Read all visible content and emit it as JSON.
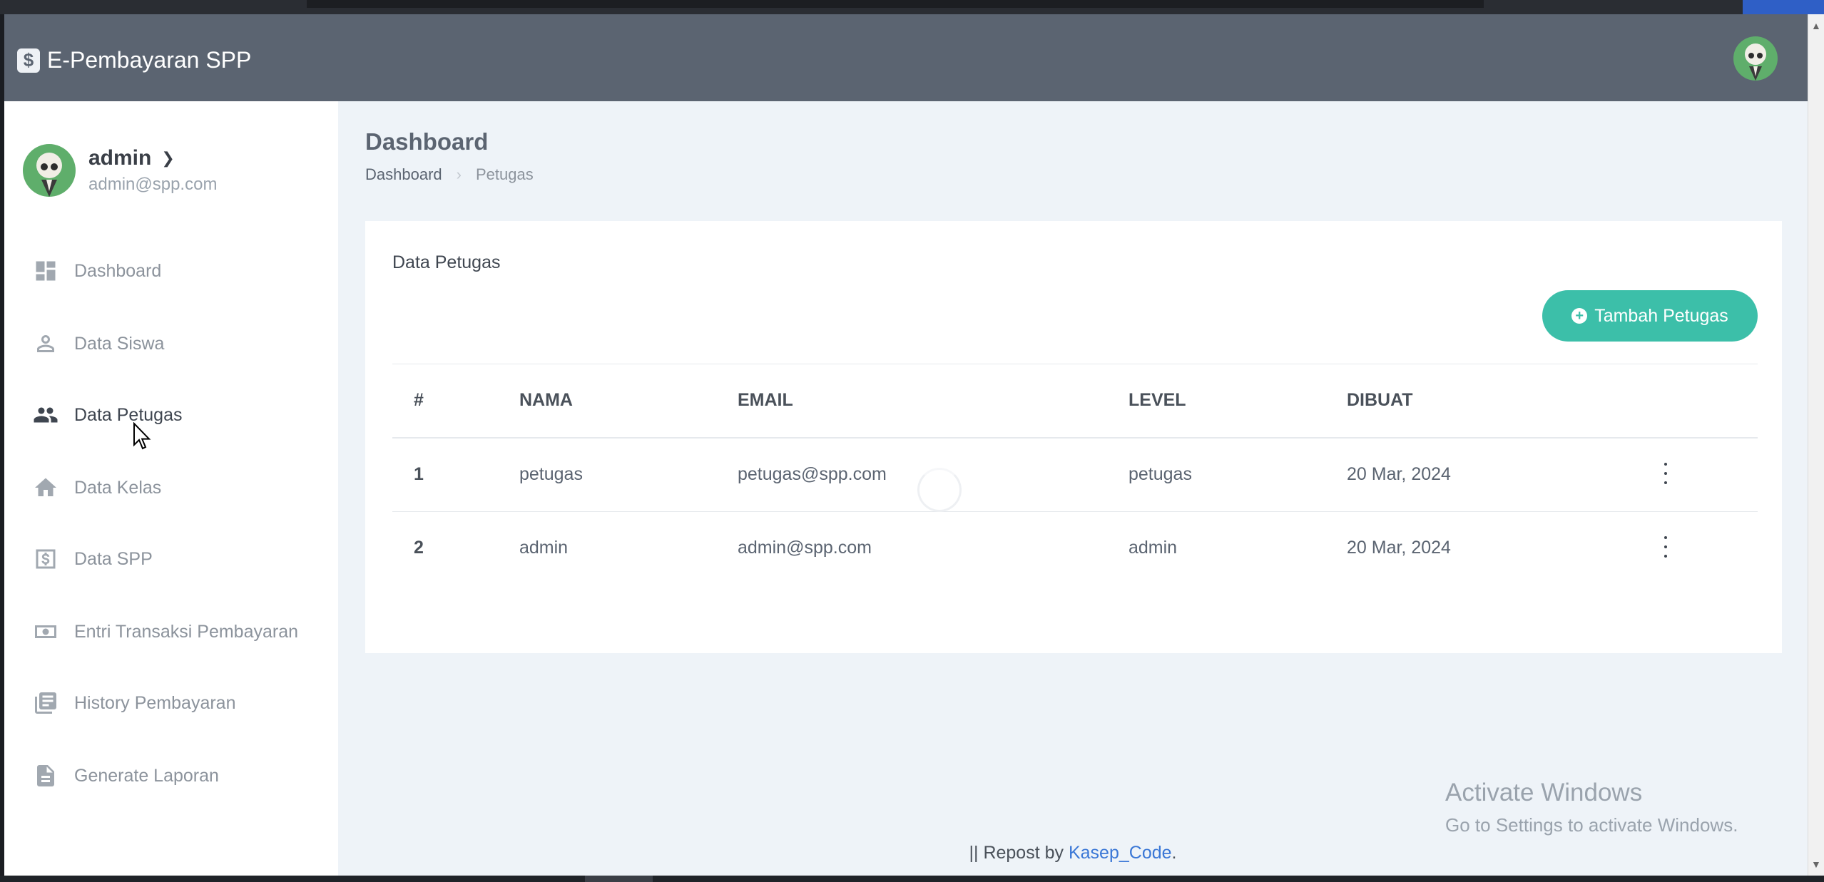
{
  "app": {
    "brand_icon": "$",
    "title": "E-Pembayaran SPP"
  },
  "user": {
    "name": "admin",
    "email": "admin@spp.com"
  },
  "sidebar": {
    "items": [
      {
        "label": "Dashboard",
        "icon": "dashboard-icon"
      },
      {
        "label": "Data Siswa",
        "icon": "person-icon"
      },
      {
        "label": "Data Petugas",
        "icon": "people-icon",
        "active": true
      },
      {
        "label": "Data Kelas",
        "icon": "home-icon"
      },
      {
        "label": "Data SPP",
        "icon": "dollar-icon"
      },
      {
        "label": "Entri Transaksi Pembayaran",
        "icon": "money-icon"
      },
      {
        "label": "History Pembayaran",
        "icon": "documents-icon"
      },
      {
        "label": "Generate Laporan",
        "icon": "report-icon"
      }
    ]
  },
  "page": {
    "title": "Dashboard",
    "breadcrumb": [
      "Dashboard",
      "Petugas"
    ]
  },
  "card": {
    "title": "Data Petugas",
    "add_button": "Tambah Petugas"
  },
  "table": {
    "headers": [
      "#",
      "NAMA",
      "EMAIL",
      "LEVEL",
      "DIBUAT"
    ],
    "rows": [
      [
        "1",
        "petugas",
        "petugas@spp.com",
        "petugas",
        "20 Mar, 2024"
      ],
      [
        "2",
        "admin",
        "admin@spp.com",
        "admin",
        "20 Mar, 2024"
      ]
    ]
  },
  "watermark": {
    "line1": "Activate Windows",
    "line2": "Go to Settings to activate Windows."
  },
  "footer": {
    "prefix": "|| Repost by ",
    "link": "Kasep_Code",
    "suffix": "."
  },
  "colors": {
    "navbar": "#5b6471",
    "accent": "#3cbfa9",
    "link": "#3a77d6"
  }
}
